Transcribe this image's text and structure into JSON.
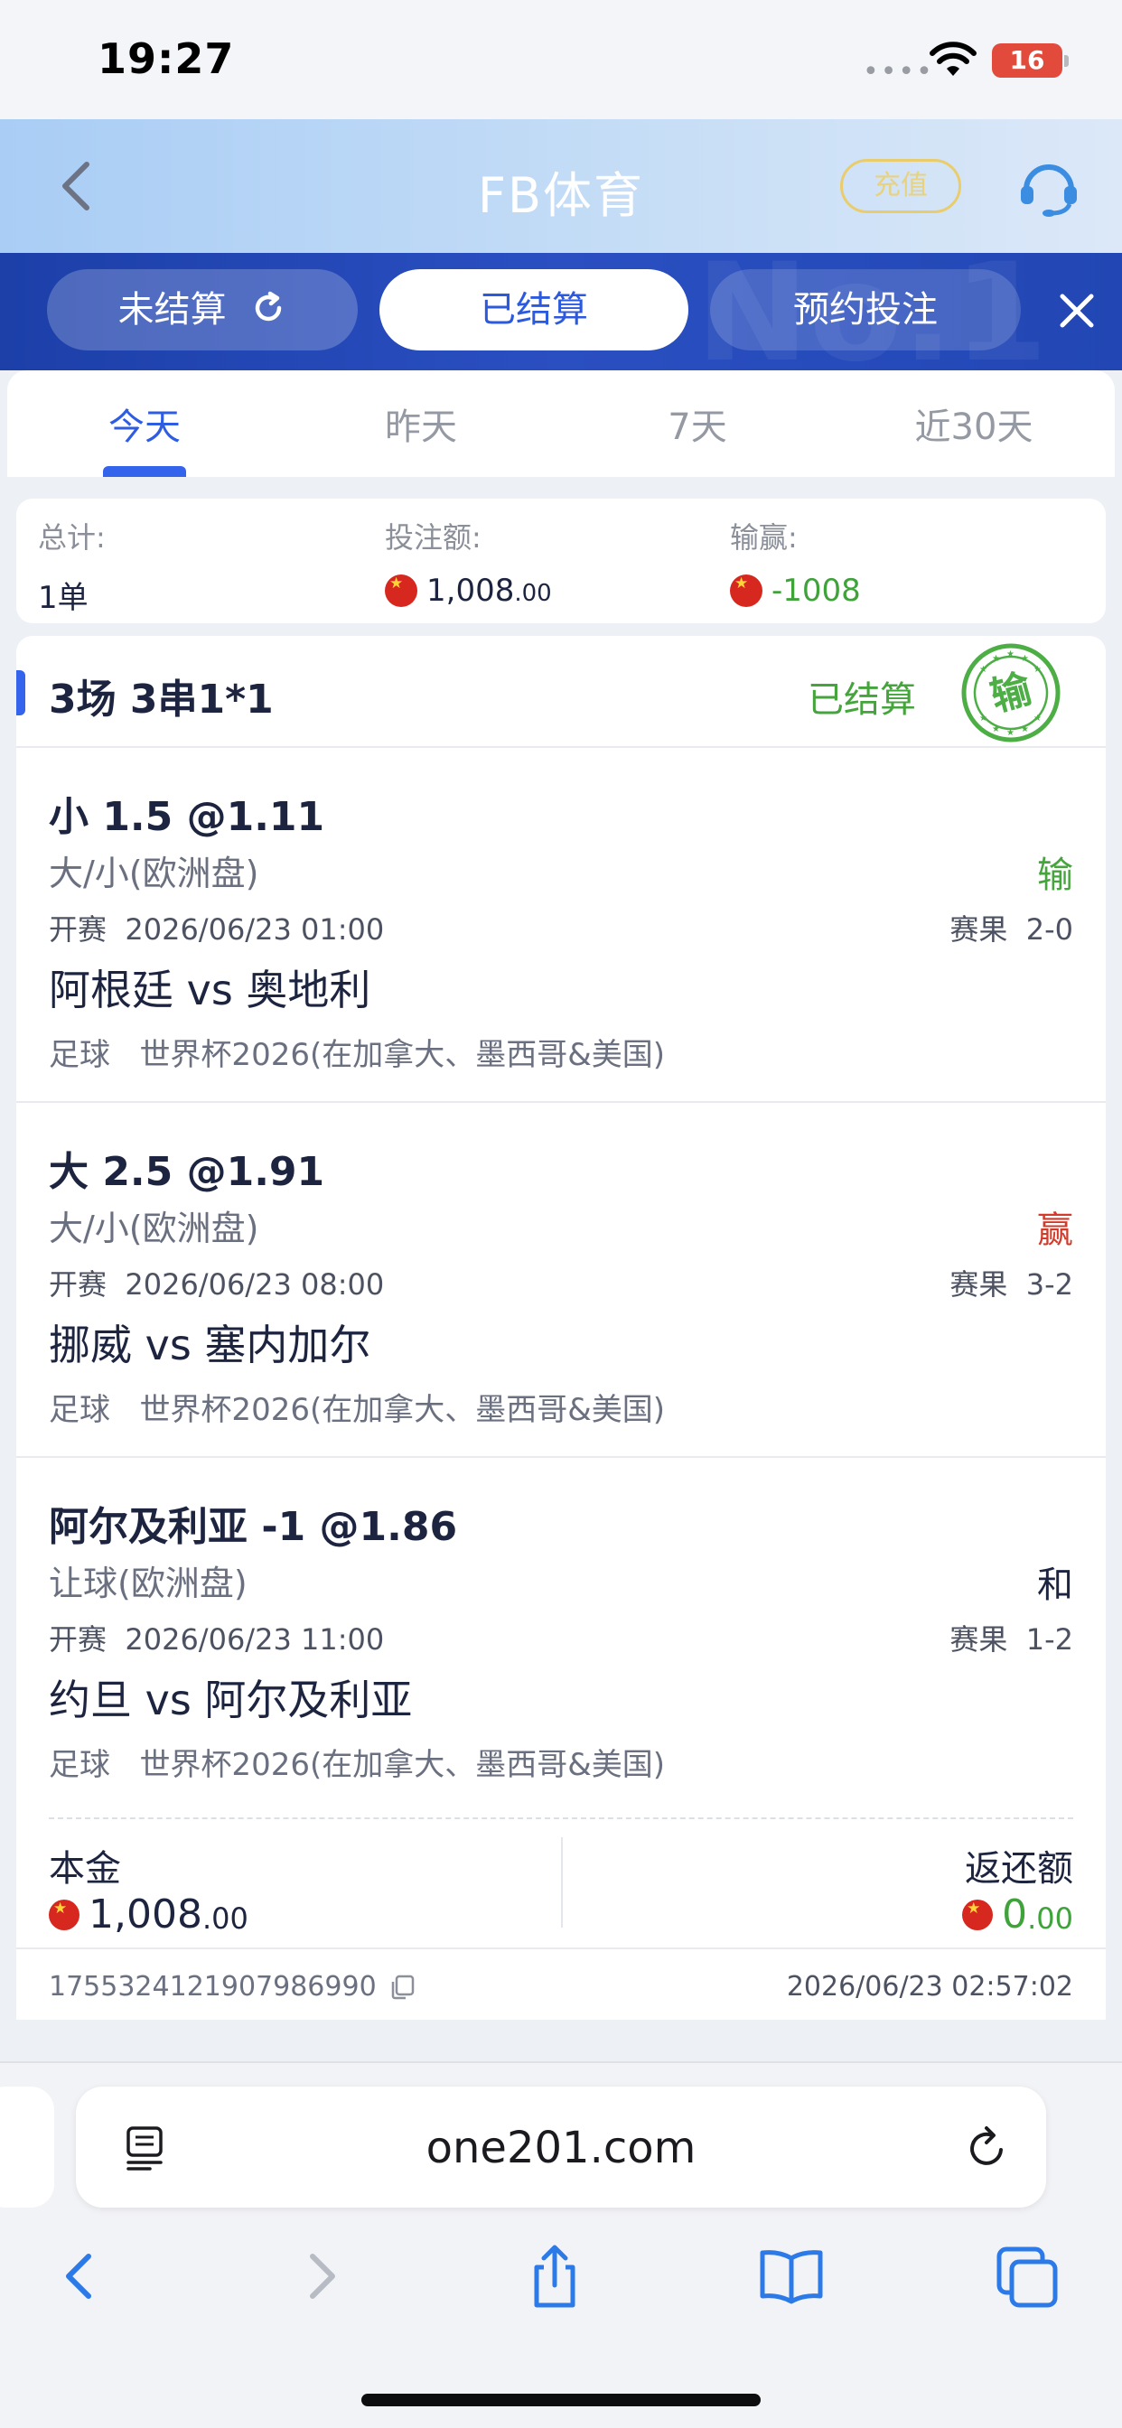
{
  "status_bar": {
    "time": "19:27",
    "signal": "••••",
    "battery": "16"
  },
  "header": {
    "title": "FB体育",
    "recharge_label": "充值"
  },
  "bet_tabs": [
    {
      "label": "未结算"
    },
    {
      "label": "已结算"
    },
    {
      "label": "预约投注"
    }
  ],
  "tabstrip_watermark": "No.1",
  "day_tabs": [
    {
      "label": "今天"
    },
    {
      "label": "昨天"
    },
    {
      "label": "7天"
    },
    {
      "label": "近30天"
    }
  ],
  "summary": {
    "total_label": "总计:",
    "total_value": "1单",
    "stake_label": "投注额:",
    "stake_main": "1,008",
    "stake_decimal": ".00",
    "pnl_label": "输赢:",
    "pnl_value": "-1008"
  },
  "bet": {
    "name": "3场 3串1*1",
    "status": "已结算",
    "stamp_text": "输",
    "legs": [
      {
        "pick": "小 1.5 @1.11",
        "market": "大/小(欧洲盘)",
        "result": "输",
        "start_label": "开赛",
        "start_time": "2026/06/23 01:00",
        "score_label": "赛果",
        "score": "2-0",
        "teams": "阿根廷 vs 奥地利",
        "sport": "足球",
        "league": "世界杯2026(在加拿大、墨西哥&美国)"
      },
      {
        "pick": "大 2.5 @1.91",
        "market": "大/小(欧洲盘)",
        "result": "赢",
        "start_label": "开赛",
        "start_time": "2026/06/23 08:00",
        "score_label": "赛果",
        "score": "3-2",
        "teams": "挪威 vs 塞内加尔",
        "sport": "足球",
        "league": "世界杯2026(在加拿大、墨西哥&美国)"
      },
      {
        "pick": "阿尔及利亚 -1 @1.86",
        "market": "让球(欧洲盘)",
        "result": "和",
        "start_label": "开赛",
        "start_time": "2026/06/23 11:00",
        "score_label": "赛果",
        "score": "1-2",
        "teams": "约旦 vs 阿尔及利亚",
        "sport": "足球",
        "league": "世界杯2026(在加拿大、墨西哥&美国)"
      }
    ],
    "principal_label": "本金",
    "principal_main": "1,008",
    "principal_decimal": ".00",
    "return_label": "返还额",
    "return_main": "0",
    "return_decimal": ".00",
    "order_id": "1755324121907986990",
    "order_time": "2026/06/23 02:57:02"
  },
  "browser": {
    "url": "one201.com"
  },
  "colors": {
    "accent_blue": "#3463ec",
    "tab_strip": "#2247b4",
    "win_red": "#d23a2a",
    "lose_green": "#45a43c"
  }
}
